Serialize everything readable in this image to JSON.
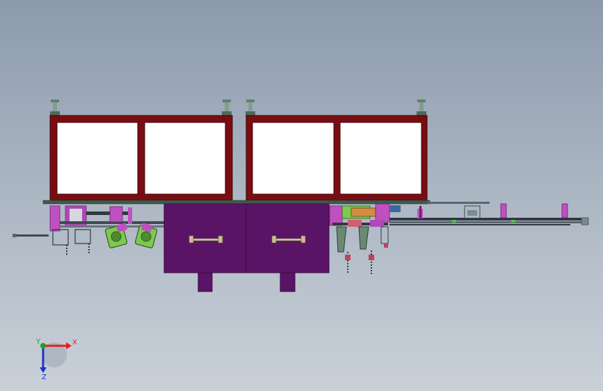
{
  "viewport": {
    "background_top": "#8c9aac",
    "background_bottom": "#c9d0d8"
  },
  "colors": {
    "frame": "#7a0d12",
    "panel": "#ffffff",
    "cabinet": "#5a1466",
    "cabinet_edge": "#3a0a44",
    "magenta_part": "#c050c0",
    "green_part": "#7ec850",
    "rail": "#404850",
    "foot": "#6a8a7a"
  },
  "triad": {
    "x_label": "X",
    "y_label": "Y",
    "z_label": "Z",
    "x_color": "#e02020",
    "y_color": "#20a020",
    "z_color": "#2030d0"
  }
}
